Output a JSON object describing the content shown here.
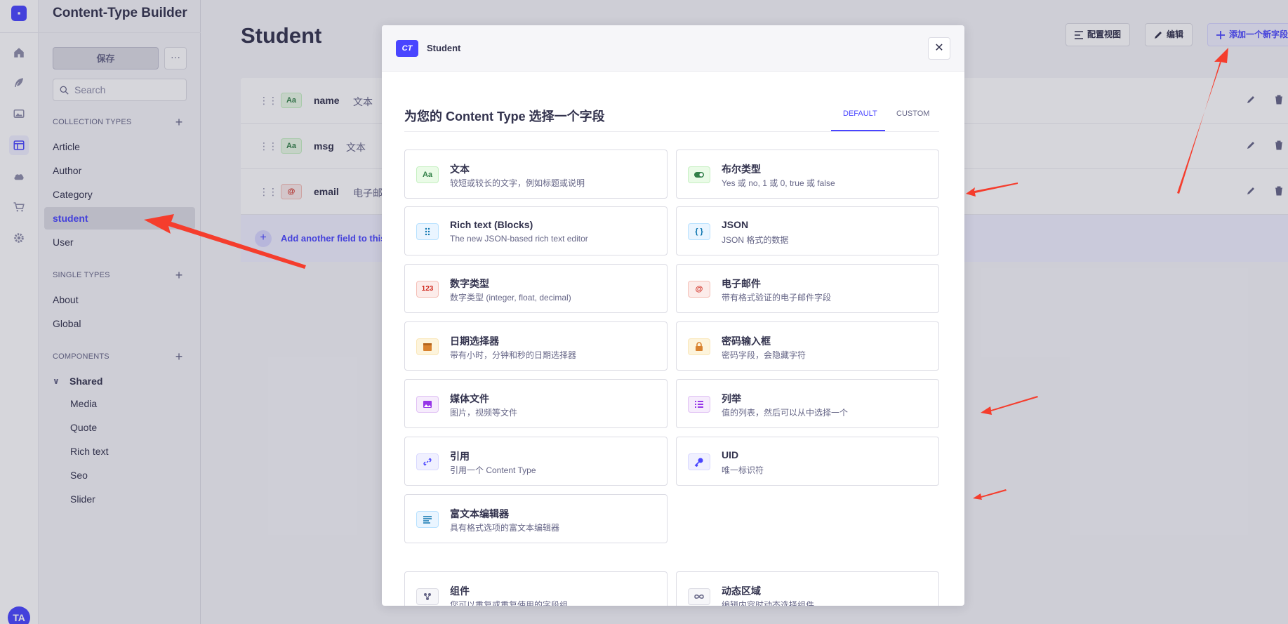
{
  "rail": {
    "avatar": "TA"
  },
  "sidebar": {
    "title": "Content-Type Builder",
    "save_label": "保存",
    "more_label": "···",
    "search_placeholder": "Search",
    "collection_header": "COLLECTION TYPES",
    "collections": [
      "Article",
      "Author",
      "Category",
      "student",
      "User"
    ],
    "single_header": "SINGLE TYPES",
    "singles": [
      "About",
      "Global"
    ],
    "components_header": "COMPONENTS",
    "group": "Shared",
    "components": [
      "Media",
      "Quote",
      "Rich text",
      "Seo",
      "Slider"
    ]
  },
  "main": {
    "title": "Student",
    "config_view": "配置视图",
    "edit": "编辑",
    "add_field": "添加一个新字段",
    "fields": [
      {
        "badge": "Aa",
        "name": "name",
        "type": "文本"
      },
      {
        "badge": "Aa",
        "name": "msg",
        "type": "文本"
      },
      {
        "badge": "@",
        "name": "email",
        "type": "电子邮件"
      }
    ],
    "add_another": "Add another field to this collection type"
  },
  "modal": {
    "ct_badge": "CT",
    "title": "Student",
    "heading": "为您的 Content Type 选择一个字段",
    "tab_default": "DEFAULT",
    "tab_custom": "CUSTOM",
    "cards": [
      {
        "icon": "Aa",
        "title": "文本",
        "desc": "较短或较长的文字，例如标题或说明"
      },
      {
        "icon": "toggle-icon",
        "title": "布尔类型",
        "desc": "Yes 或 no, 1 或 0, true 或 false"
      },
      {
        "icon": "blocks-icon",
        "title": "Rich text (Blocks)",
        "desc": "The new JSON-based rich text editor"
      },
      {
        "icon": "{ }",
        "title": "JSON",
        "desc": "JSON 格式的数据"
      },
      {
        "icon": "123",
        "title": "数字类型",
        "desc": "数字类型 (integer, float, decimal)"
      },
      {
        "icon": "@",
        "title": "电子邮件",
        "desc": "带有格式验证的电子邮件字段"
      },
      {
        "icon": "calendar-icon",
        "title": "日期选择器",
        "desc": "带有小时，分钟和秒的日期选择器"
      },
      {
        "icon": "lock-icon",
        "title": "密码输入框",
        "desc": "密码字段，会隐藏字符"
      },
      {
        "icon": "image-icon",
        "title": "媒体文件",
        "desc": "图片，视频等文件"
      },
      {
        "icon": "list-icon",
        "title": "列举",
        "desc": "值的列表，然后可以从中选择一个"
      },
      {
        "icon": "link-icon",
        "title": "引用",
        "desc": "引用一个 Content Type"
      },
      {
        "icon": "key-icon",
        "title": "UID",
        "desc": "唯一标识符"
      },
      {
        "icon": "paragraph-icon",
        "title": "富文本编辑器",
        "desc": "具有格式选项的富文本编辑器"
      },
      {
        "icon": "component-icon",
        "title": "组件",
        "desc": "您可以重复或重复使用的字段组"
      },
      {
        "icon": "infinity-icon",
        "title": "动态区域",
        "desc": "编辑内容时动态选择组件"
      }
    ]
  },
  "colors": {
    "accent": "#4945ff",
    "annotation_arrow": "#f53d2d"
  }
}
